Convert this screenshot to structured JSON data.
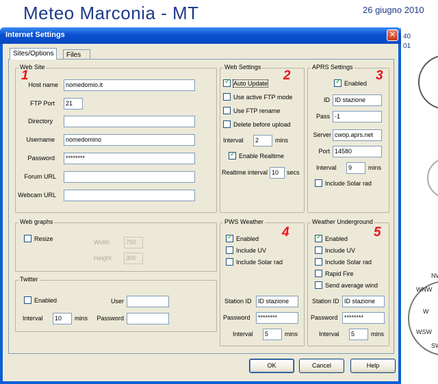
{
  "background": {
    "site_title": "Meteo Marconia - MT",
    "date_text": "26 giugno 2010",
    "side_numbers": [
      "40",
      "01"
    ],
    "compass_labels": [
      "NW",
      "WNW",
      "W",
      "WSW",
      "SW"
    ]
  },
  "dialog": {
    "title": "Internet Settings",
    "close_label": "✕",
    "tabs": [
      "Sites/Options",
      "Files"
    ],
    "web_site": {
      "title": "Web Site",
      "marker": "1",
      "fields": [
        {
          "label": "Host name",
          "value": "nomedomio.it"
        },
        {
          "label": "FTP Port",
          "value": "21"
        },
        {
          "label": "Directory",
          "value": ""
        },
        {
          "label": "Username",
          "value": "nomedomino"
        },
        {
          "label": "Password",
          "value": "********"
        },
        {
          "label": "Forum URL",
          "value": ""
        },
        {
          "label": "Webcam URL",
          "value": ""
        }
      ]
    },
    "web_settings": {
      "title": "Web Settings",
      "marker": "2",
      "auto_update": "Auto Update",
      "active_ftp": "Use active FTP mode",
      "ftp_rename": "Use FTP rename",
      "delete_before": "Delete before upload",
      "interval_label": "Interval",
      "interval_value": "2",
      "interval_unit": "mins",
      "enable_realtime": "Enable Realtime",
      "realtime_label": "Realtime interval",
      "realtime_value": "10",
      "realtime_unit": "secs"
    },
    "aprs": {
      "title": "APRS Settings",
      "marker": "3",
      "enabled": "Enabled",
      "id_label": "ID",
      "id_value": "ID stazione",
      "pass_label": "Pass",
      "pass_value": "-1",
      "server_label": "Server",
      "server_value": "cwop.aprs.net",
      "port_label": "Port",
      "port_value": "14580",
      "interval_label": "Interval",
      "interval_value": "9",
      "interval_unit": "mins",
      "solar": "Include Solar rad"
    },
    "web_graphs": {
      "title": "Web graphs",
      "resize": "Resize",
      "width_label": "Width",
      "width_value": "750",
      "height_label": "Height",
      "height_value": "300"
    },
    "twitter": {
      "title": "Twitter",
      "enabled": "Enabled",
      "user_label": "User",
      "user_value": "",
      "interval_label": "Interval",
      "interval_value": "10",
      "interval_unit": "mins",
      "password_label": "Password",
      "password_value": ""
    },
    "pws": {
      "title": "PWS Weather",
      "marker": "4",
      "enabled": "Enabled",
      "uv": "Include UV",
      "solar": "Include Solar rad",
      "station_label": "Station ID",
      "station_value": "ID stazione",
      "password_label": "Password",
      "password_value": "********",
      "interval_label": "Interval",
      "interval_value": "5",
      "interval_unit": "mins"
    },
    "wu": {
      "title": "Weather Underground",
      "marker": "5",
      "enabled": "Enabled",
      "uv": "Include UV",
      "solar": "Include Solar rad",
      "rapid": "Rapid Fire",
      "avg_wind": "Send average wind",
      "station_label": "Station ID",
      "station_value": "ID stazione",
      "password_label": "Password",
      "password_value": "********",
      "interval_label": "Interval",
      "interval_value": "5",
      "interval_unit": "mins"
    },
    "buttons": {
      "ok": "OK",
      "cancel": "Cancel",
      "help": "Help"
    }
  }
}
